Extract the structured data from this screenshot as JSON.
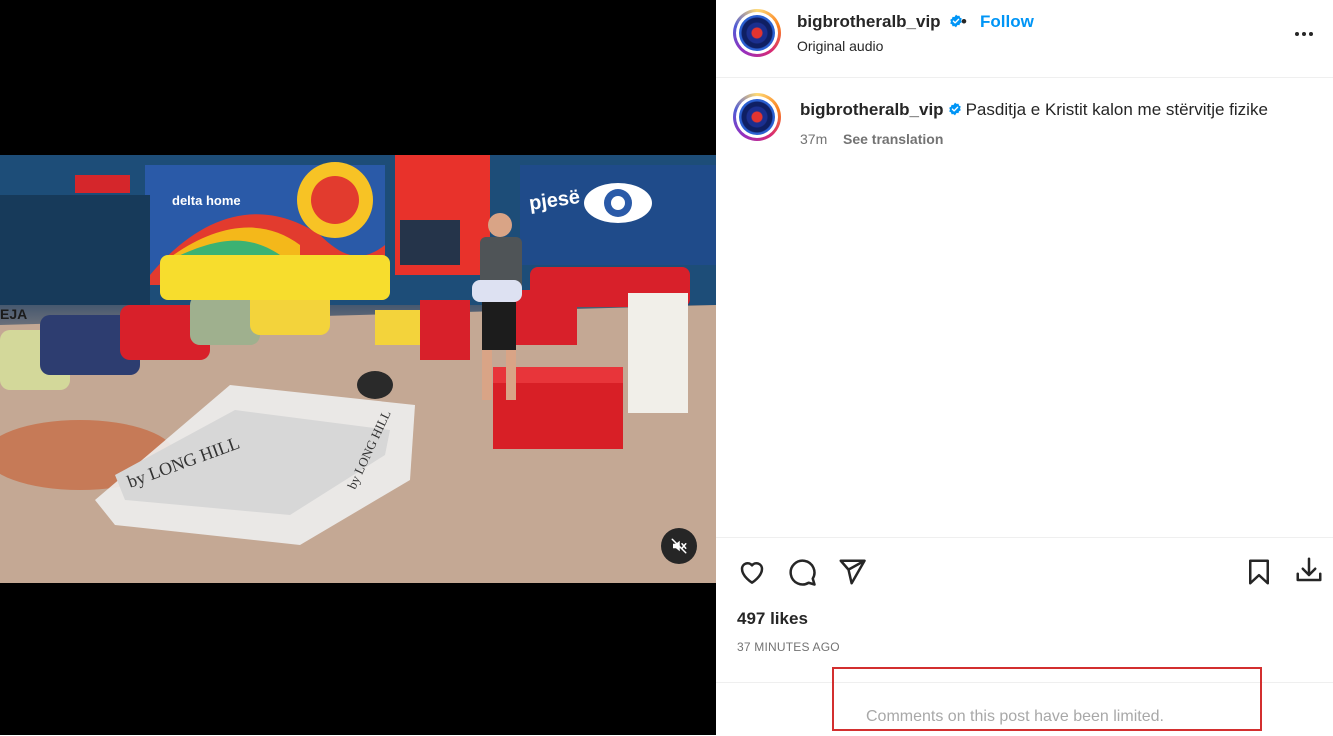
{
  "header": {
    "username": "bigbrotheralb_vip",
    "separator": "•",
    "follow_label": "Follow",
    "audio": "Original audio",
    "more_icon": "more-horizontal-icon"
  },
  "caption": {
    "username": "bigbrotheralb_vip",
    "text": "Pasditja e Kristit kalon me stërvitje fizike",
    "time": "37m",
    "translate_label": "See translation"
  },
  "video": {
    "mute_icon": "speaker-muted-icon",
    "overlay_texts": {
      "sign_left": "delta home",
      "sign_right": "pjesë",
      "model_brand": "by LONG HILL",
      "model_brand_side": "by LONG HILL",
      "wall_label": "EJA"
    }
  },
  "actions": {
    "like_icon": "heart-icon",
    "comment_icon": "comment-icon",
    "share_icon": "send-icon",
    "save_icon": "bookmark-icon",
    "download_icon": "download-icon",
    "likes": "497 likes",
    "timestamp": "37 MINUTES AGO"
  },
  "comments": {
    "limited_text": "Comments on this post have been limited."
  },
  "colors": {
    "link_blue": "#0095f6",
    "verified_blue": "#0095f6",
    "secondary_text": "#737373",
    "highlight_red": "#d32f2f"
  }
}
